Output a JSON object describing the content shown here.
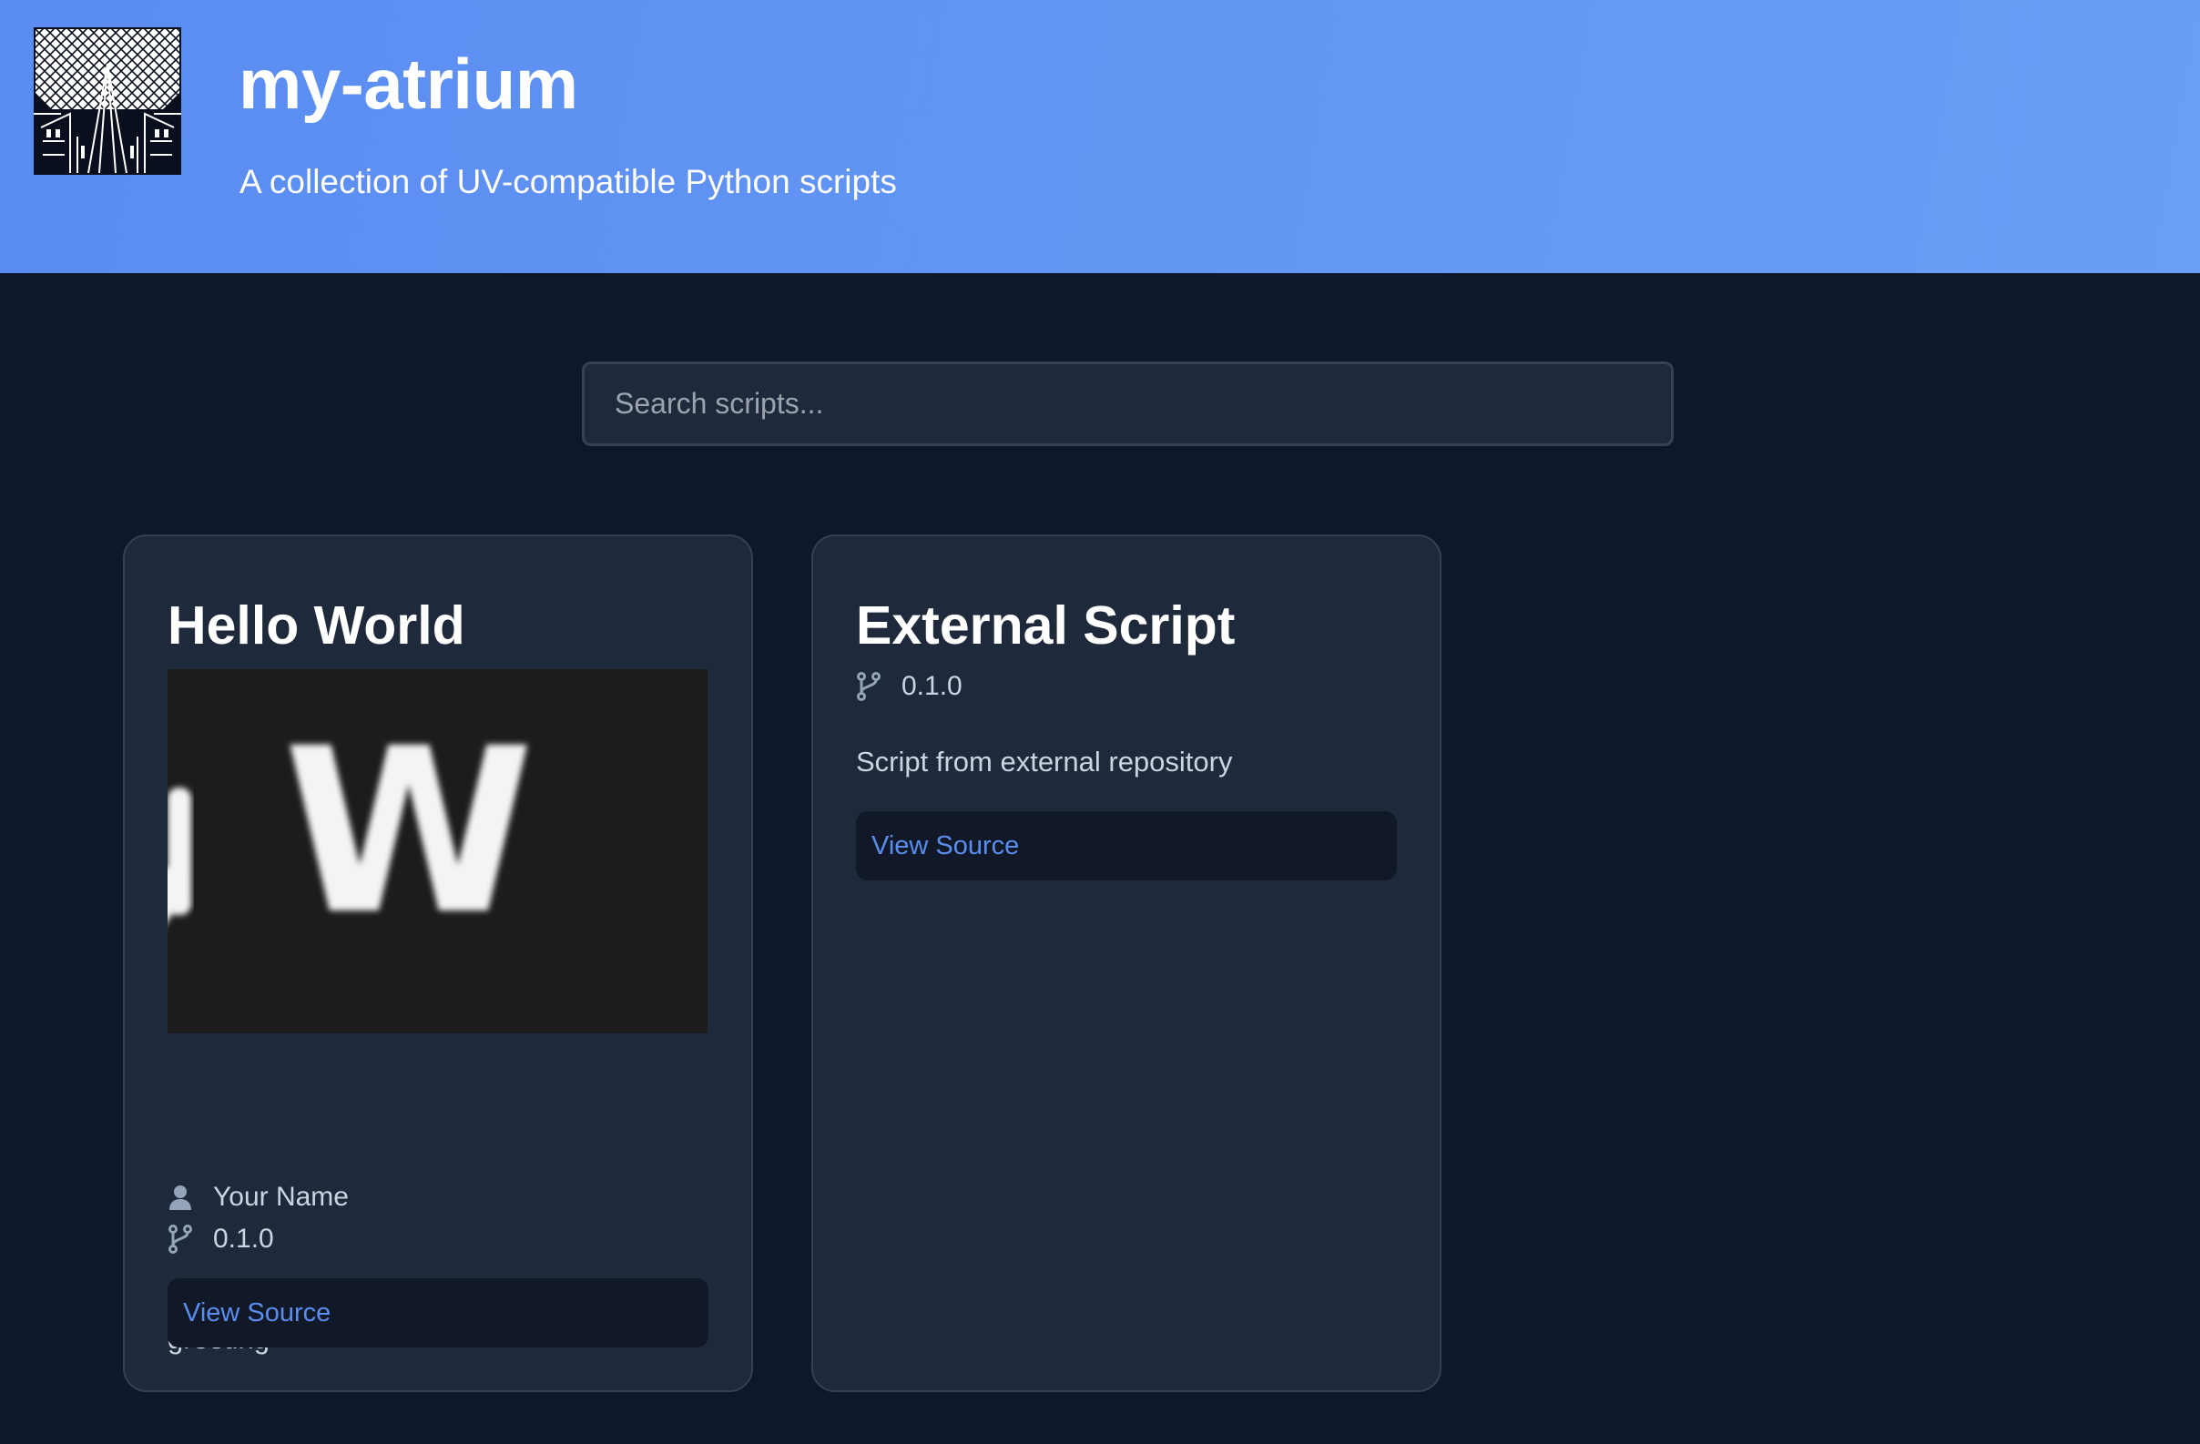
{
  "header": {
    "title": "my-atrium",
    "subtitle": "A collection of UV-compatible Python scripts",
    "logo_icon": "atrium-glass-ceiling-logo"
  },
  "search": {
    "placeholder": "Search scripts..."
  },
  "scripts": [
    {
      "title": "Hello World",
      "image_text": ", W",
      "author": "Your Name",
      "version": "0.1.0",
      "description": "A simple example script that prints a greeting",
      "button_label": "View Source"
    },
    {
      "title": "External Script",
      "version": "0.1.0",
      "description": "Script from external repository",
      "button_label": "View Source"
    }
  ],
  "colors": {
    "header_gradient_start": "#5a8cf1",
    "header_gradient_end": "#6a9ff5",
    "page_background": "#0f172a",
    "card_background": "#1e293b",
    "button_background": "#111827",
    "link_color": "#5b8def",
    "muted_text": "#cbd5e1"
  },
  "icons": {
    "author": "user-icon",
    "version": "git-branch-icon"
  }
}
